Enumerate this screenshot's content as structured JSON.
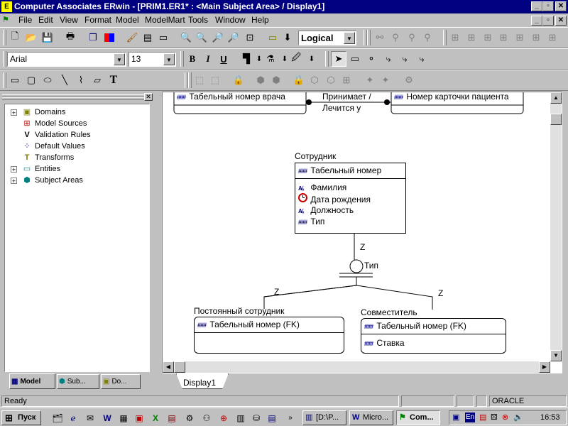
{
  "window": {
    "title": "Computer Associates ERwin - [PRIM1.ER1* : <Main Subject Area> / Display1]",
    "app_icon": "erwin-app-icon"
  },
  "menu": {
    "items": [
      "File",
      "Edit",
      "View",
      "Format",
      "Model",
      "ModelMart",
      "Tools",
      "Window",
      "Help"
    ]
  },
  "toolbar1": {
    "view_mode": "Logical",
    "buttons": [
      "new",
      "open",
      "save",
      "print",
      "copy",
      "color",
      "format-painter",
      "report",
      "report2",
      "zoom-out",
      "zoom-in",
      "zoom-fit",
      "zoom-normal",
      "zoom-all",
      "display",
      "dropdown"
    ]
  },
  "toolbar2": {
    "font": "Arial",
    "size": "13",
    "bold": "B",
    "italic": "I",
    "underline": "U"
  },
  "toolbar3": {
    "text_tool": "T"
  },
  "tree": {
    "items": [
      {
        "label": "Domains",
        "icon": "domains-icon",
        "expandable": true
      },
      {
        "label": "Model Sources",
        "icon": "model-sources-icon",
        "expandable": false
      },
      {
        "label": "Validation Rules",
        "icon": "validation-rules-icon",
        "expandable": false
      },
      {
        "label": "Default Values",
        "icon": "default-values-icon",
        "expandable": false
      },
      {
        "label": "Transforms",
        "icon": "transforms-icon",
        "expandable": false
      },
      {
        "label": "Entities",
        "icon": "entities-icon",
        "expandable": true
      },
      {
        "label": "Subject Areas",
        "icon": "subject-areas-icon",
        "expandable": true
      }
    ],
    "tabs": [
      "Model",
      "Sub...",
      "Do..."
    ]
  },
  "diagram": {
    "top_left_entity_attr": "Табельный номер врача",
    "top_right_entity_attr": "Номер карточки пациента",
    "relationship_top": "Принимает /",
    "relationship_bottom": "Лечится у",
    "employee": {
      "name": "Сотрудник",
      "key": "Табельный номер",
      "attrs": [
        {
          "label": "Фамилия",
          "icon": "text-attr-icon"
        },
        {
          "label": "Дата рождения",
          "icon": "date-attr-icon"
        },
        {
          "label": "Должность",
          "icon": "text-attr-icon"
        },
        {
          "label": "Тип",
          "icon": "key-attr-icon"
        }
      ]
    },
    "subtype_z": "Z",
    "subtype_discriminator": "Тип",
    "left_z": "Z",
    "right_z": "Z",
    "permanent": {
      "name": "Постоянный сотрудник",
      "key": "Табельный номер (FK)"
    },
    "parttime": {
      "name": "Совместитель",
      "key": "Табельный номер (FK)",
      "attr": "Ставка"
    },
    "tab": "Display1"
  },
  "status": {
    "text": "Ready",
    "db": "ORACLE"
  },
  "taskbar": {
    "start": "Пуск",
    "tasks": [
      "[D:\\P...",
      "Micro...",
      "Com..."
    ],
    "lang": "En",
    "clock": "16:53"
  }
}
